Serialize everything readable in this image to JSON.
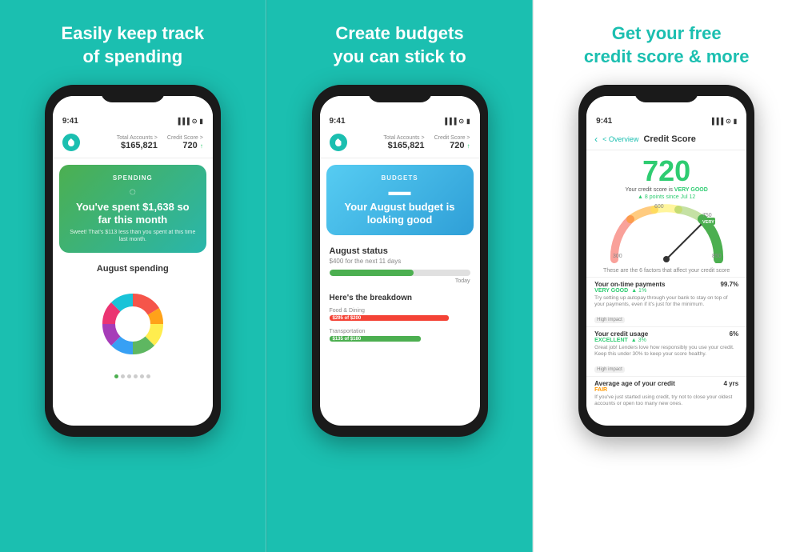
{
  "panels": [
    {
      "id": "spending",
      "bg": "teal",
      "heading_line1": "Easily keep track",
      "heading_line2": "of spending",
      "phone": {
        "time": "9:41",
        "total_accounts_label": "Total Accounts >",
        "total_accounts_value": "$165,821",
        "credit_score_label": "Credit Score >",
        "credit_score_value": "720",
        "credit_score_arrow": "↑",
        "spending_card": {
          "category": "SPENDING",
          "main_text": "You've spent $1,638 so far this month",
          "sub_text": "Sweet! That's $113 less than you spent at this time last month."
        },
        "chart_title": "August spending"
      }
    },
    {
      "id": "budgets",
      "bg": "teal",
      "heading_line1": "Create budgets",
      "heading_line2": "you can stick to",
      "phone": {
        "time": "9:41",
        "total_accounts_label": "Total Accounts >",
        "total_accounts_value": "$165,821",
        "credit_score_label": "Credit Score >",
        "credit_score_value": "720",
        "credit_score_arrow": "↑",
        "budget_card": {
          "category": "BUDGETS",
          "main_text": "Your August budget is looking good"
        },
        "status_title": "August status",
        "status_sub": "$400 for the next 11 days",
        "today_label": "Today",
        "breakdown_title": "Here's the breakdown",
        "items": [
          {
            "label": "Food & Dining",
            "bar_text": "$295 of $200",
            "color": "red",
            "pct": 85
          },
          {
            "label": "Transportation",
            "bar_text": "$135 of $180",
            "color": "green",
            "pct": 65
          }
        ]
      }
    },
    {
      "id": "credit",
      "bg": "white",
      "heading_line1": "Get your free",
      "heading_line2": "credit score & more",
      "phone": {
        "time": "9:41",
        "back_text": "< Overview",
        "screen_title": "Credit Score",
        "score": "720",
        "score_label": "Your credit score is",
        "score_status": "VERY GOOD",
        "score_change": "▲ 8 points since Jul 12",
        "factors_intro": "These are the 6 factors that affect your credit score",
        "factors": [
          {
            "name": "Your on-time payments",
            "value": "99.7%",
            "status": "VERY GOOD",
            "status_color": "green",
            "change": "▲ 1%",
            "desc": "Try setting up autopay through your bank to stay on top of your payments, even if it's just for the minimum.",
            "impact": "High impact"
          },
          {
            "name": "Your credit usage",
            "value": "6%",
            "status": "EXCELLENT",
            "status_color": "green",
            "change": "▲ 3%",
            "desc": "Great job! Lenders love how responsibly you use your credit. Keep this under 30% to keep your score healthy.",
            "impact": "High impact"
          },
          {
            "name": "Average age of your credit",
            "value": "4 yrs",
            "status": "FAIR",
            "status_color": "orange",
            "change": "",
            "desc": "If you've just started using credit, try not to close your oldest accounts or open too many new ones.",
            "impact": ""
          }
        ]
      }
    }
  ]
}
